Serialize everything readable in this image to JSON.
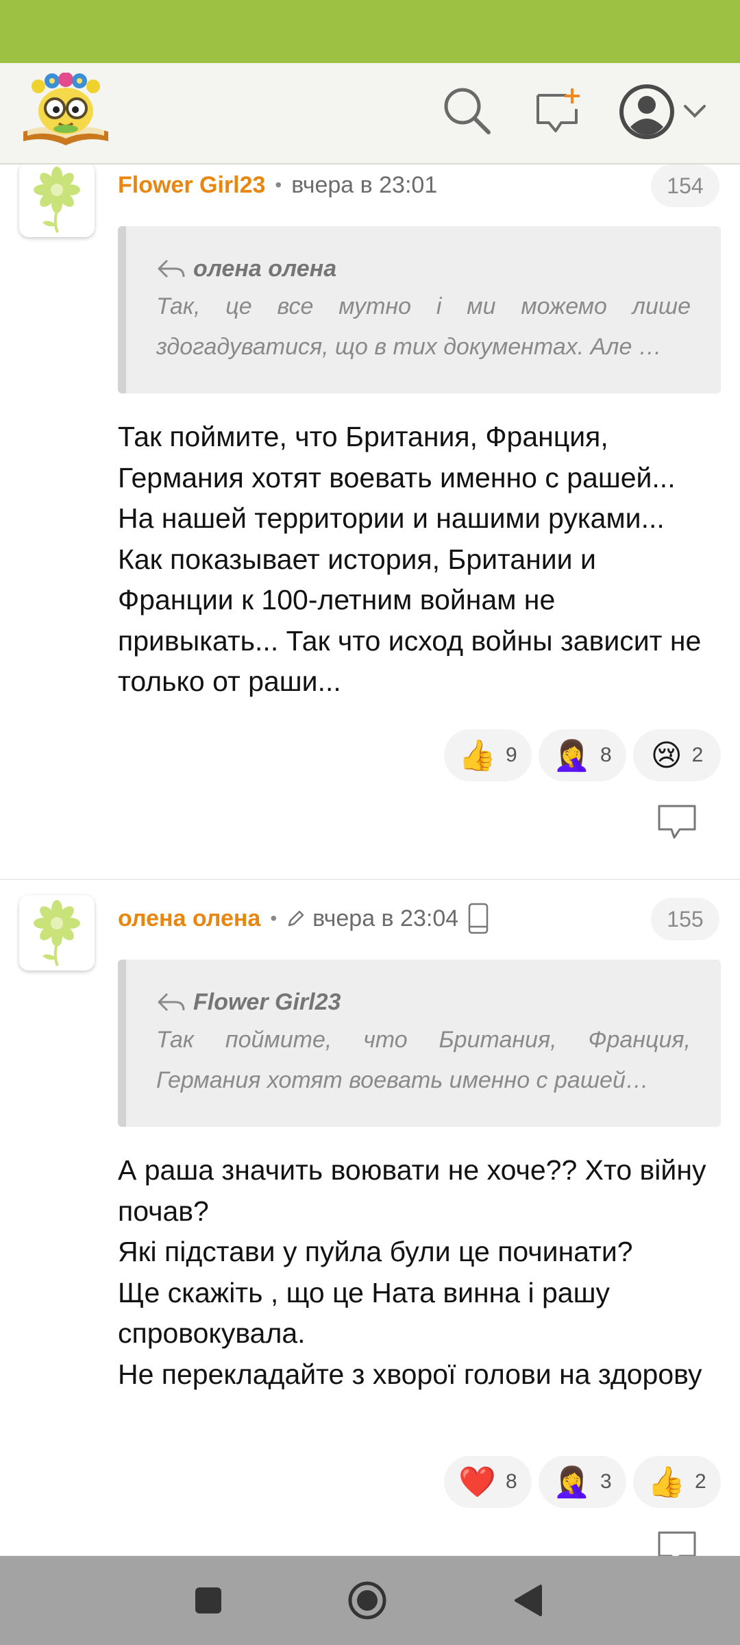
{
  "header": {
    "logo_alt": "logo",
    "icons": {
      "search": "search-icon",
      "new_message": "new-message-icon",
      "account": "account-icon",
      "chevron": "chevron-down-icon"
    }
  },
  "colors": {
    "status_bar": "#9dc143",
    "author": "#e8860f",
    "nav_bar": "#a3a3a3"
  },
  "comments": [
    {
      "author": "Flower Girl23",
      "separator": "•",
      "timestamp": "вчера в 23:01",
      "post_number": "154",
      "quote": {
        "author": "олена олена",
        "text": "Так, це все мутно і ми можемо лише здогадуватися, що в тих документах. Але …"
      },
      "body": "Так поймите, что Британия, Франция, Германия хотят воевать именно с рашей... На нашей территории и нашими руками... Как показывает история, Британии и Франции к 100-летним войнам не привыкать... Так что исход войны зависит не только от раши...",
      "reactions": [
        {
          "emoji": "👍",
          "count": "9"
        },
        {
          "emoji": "🤦‍♀️",
          "count": "8"
        },
        {
          "emoji": "😢",
          "count": "2"
        }
      ]
    },
    {
      "author": "олена олена",
      "separator": "•",
      "timestamp": "вчера в 23:04",
      "post_number": "155",
      "quote": {
        "author": "Flower Girl23",
        "text": "Так поймите, что Британия, Франция, Германия хотят воевать именно с рашей…"
      },
      "body": "А раша значить воювати не хоче?? Хто війну почав?\nЯкі підстави у пуйла були це починати?\nЩе скажіть , що це Ната винна і рашу спровокувала.\nНе перекладайте з хворої голови на здорову",
      "reactions": [
        {
          "emoji": "❤️",
          "count": "8"
        },
        {
          "emoji": "🤦‍♀️",
          "count": "3"
        },
        {
          "emoji": "👍",
          "count": "2"
        }
      ]
    }
  ],
  "nav": {
    "recents": "recents-icon",
    "home": "home-icon",
    "back": "back-icon"
  }
}
